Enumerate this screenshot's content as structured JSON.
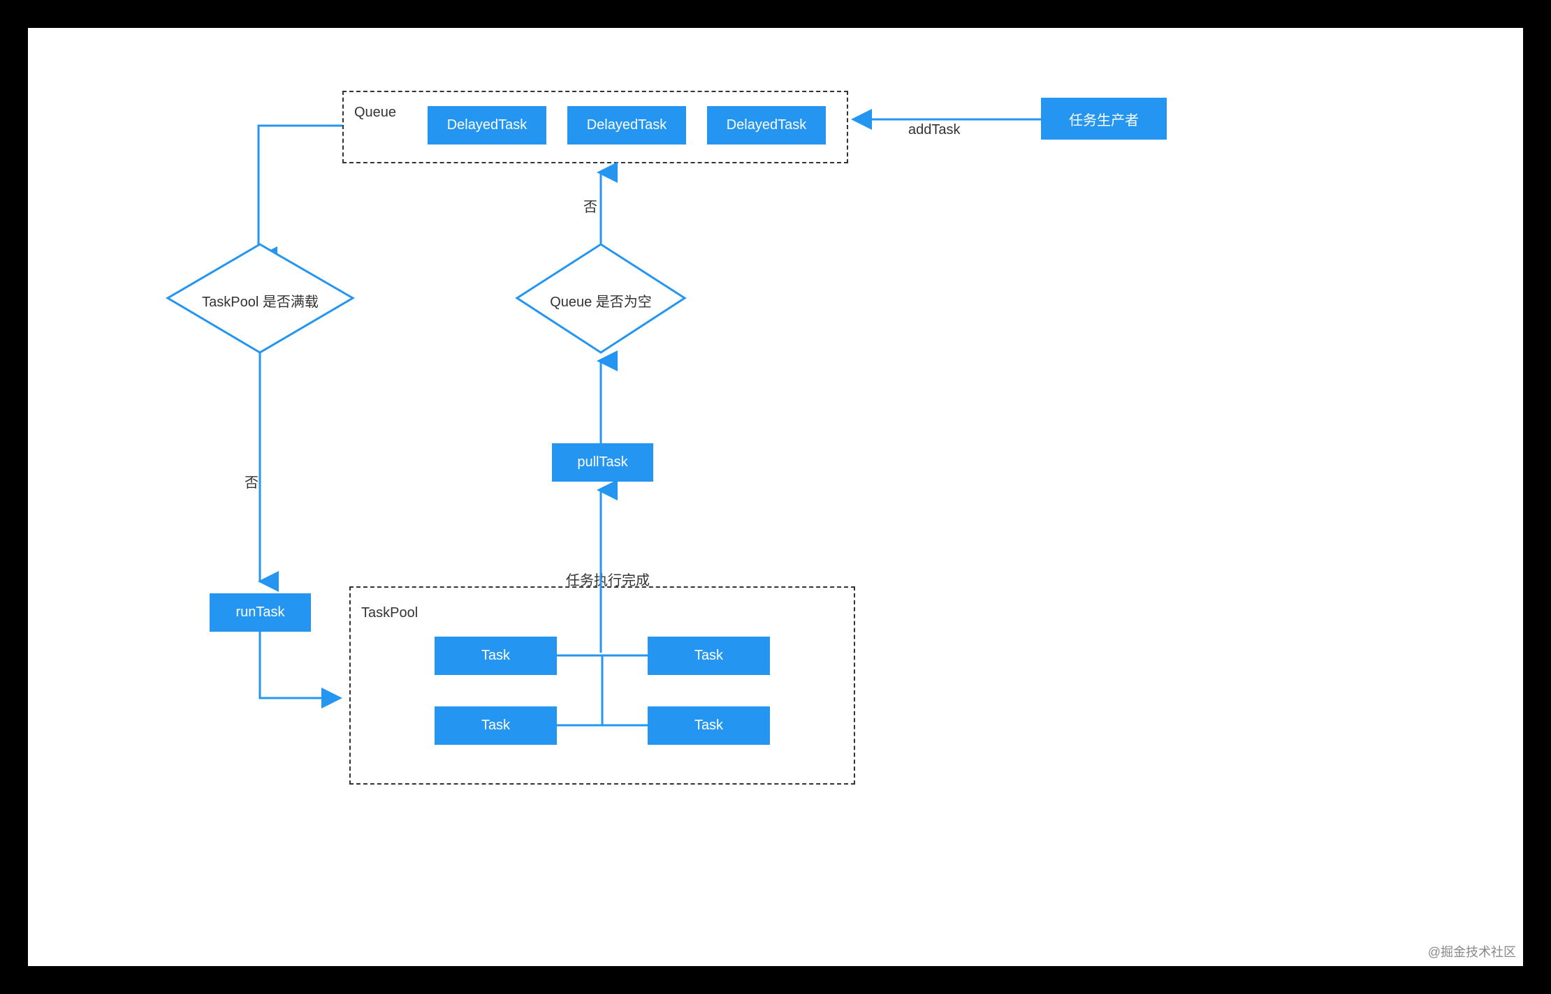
{
  "queue": {
    "title": "Queue",
    "items": [
      "DelayedTask",
      "DelayedTask",
      "DelayedTask"
    ]
  },
  "producer": {
    "label": "任务生产者",
    "action": "addTask"
  },
  "decisions": {
    "taskpool_full": {
      "label": "TaskPool 是否满载",
      "no": "否"
    },
    "queue_empty": {
      "label": "Queue 是否为空",
      "no": "否"
    }
  },
  "actions": {
    "runTask": "runTask",
    "pullTask": "pullTask"
  },
  "taskpool": {
    "title": "TaskPool",
    "done_label": "任务执行完成",
    "tasks": [
      "Task",
      "Task",
      "Task",
      "Task"
    ]
  },
  "watermark": "@掘金技术社区"
}
